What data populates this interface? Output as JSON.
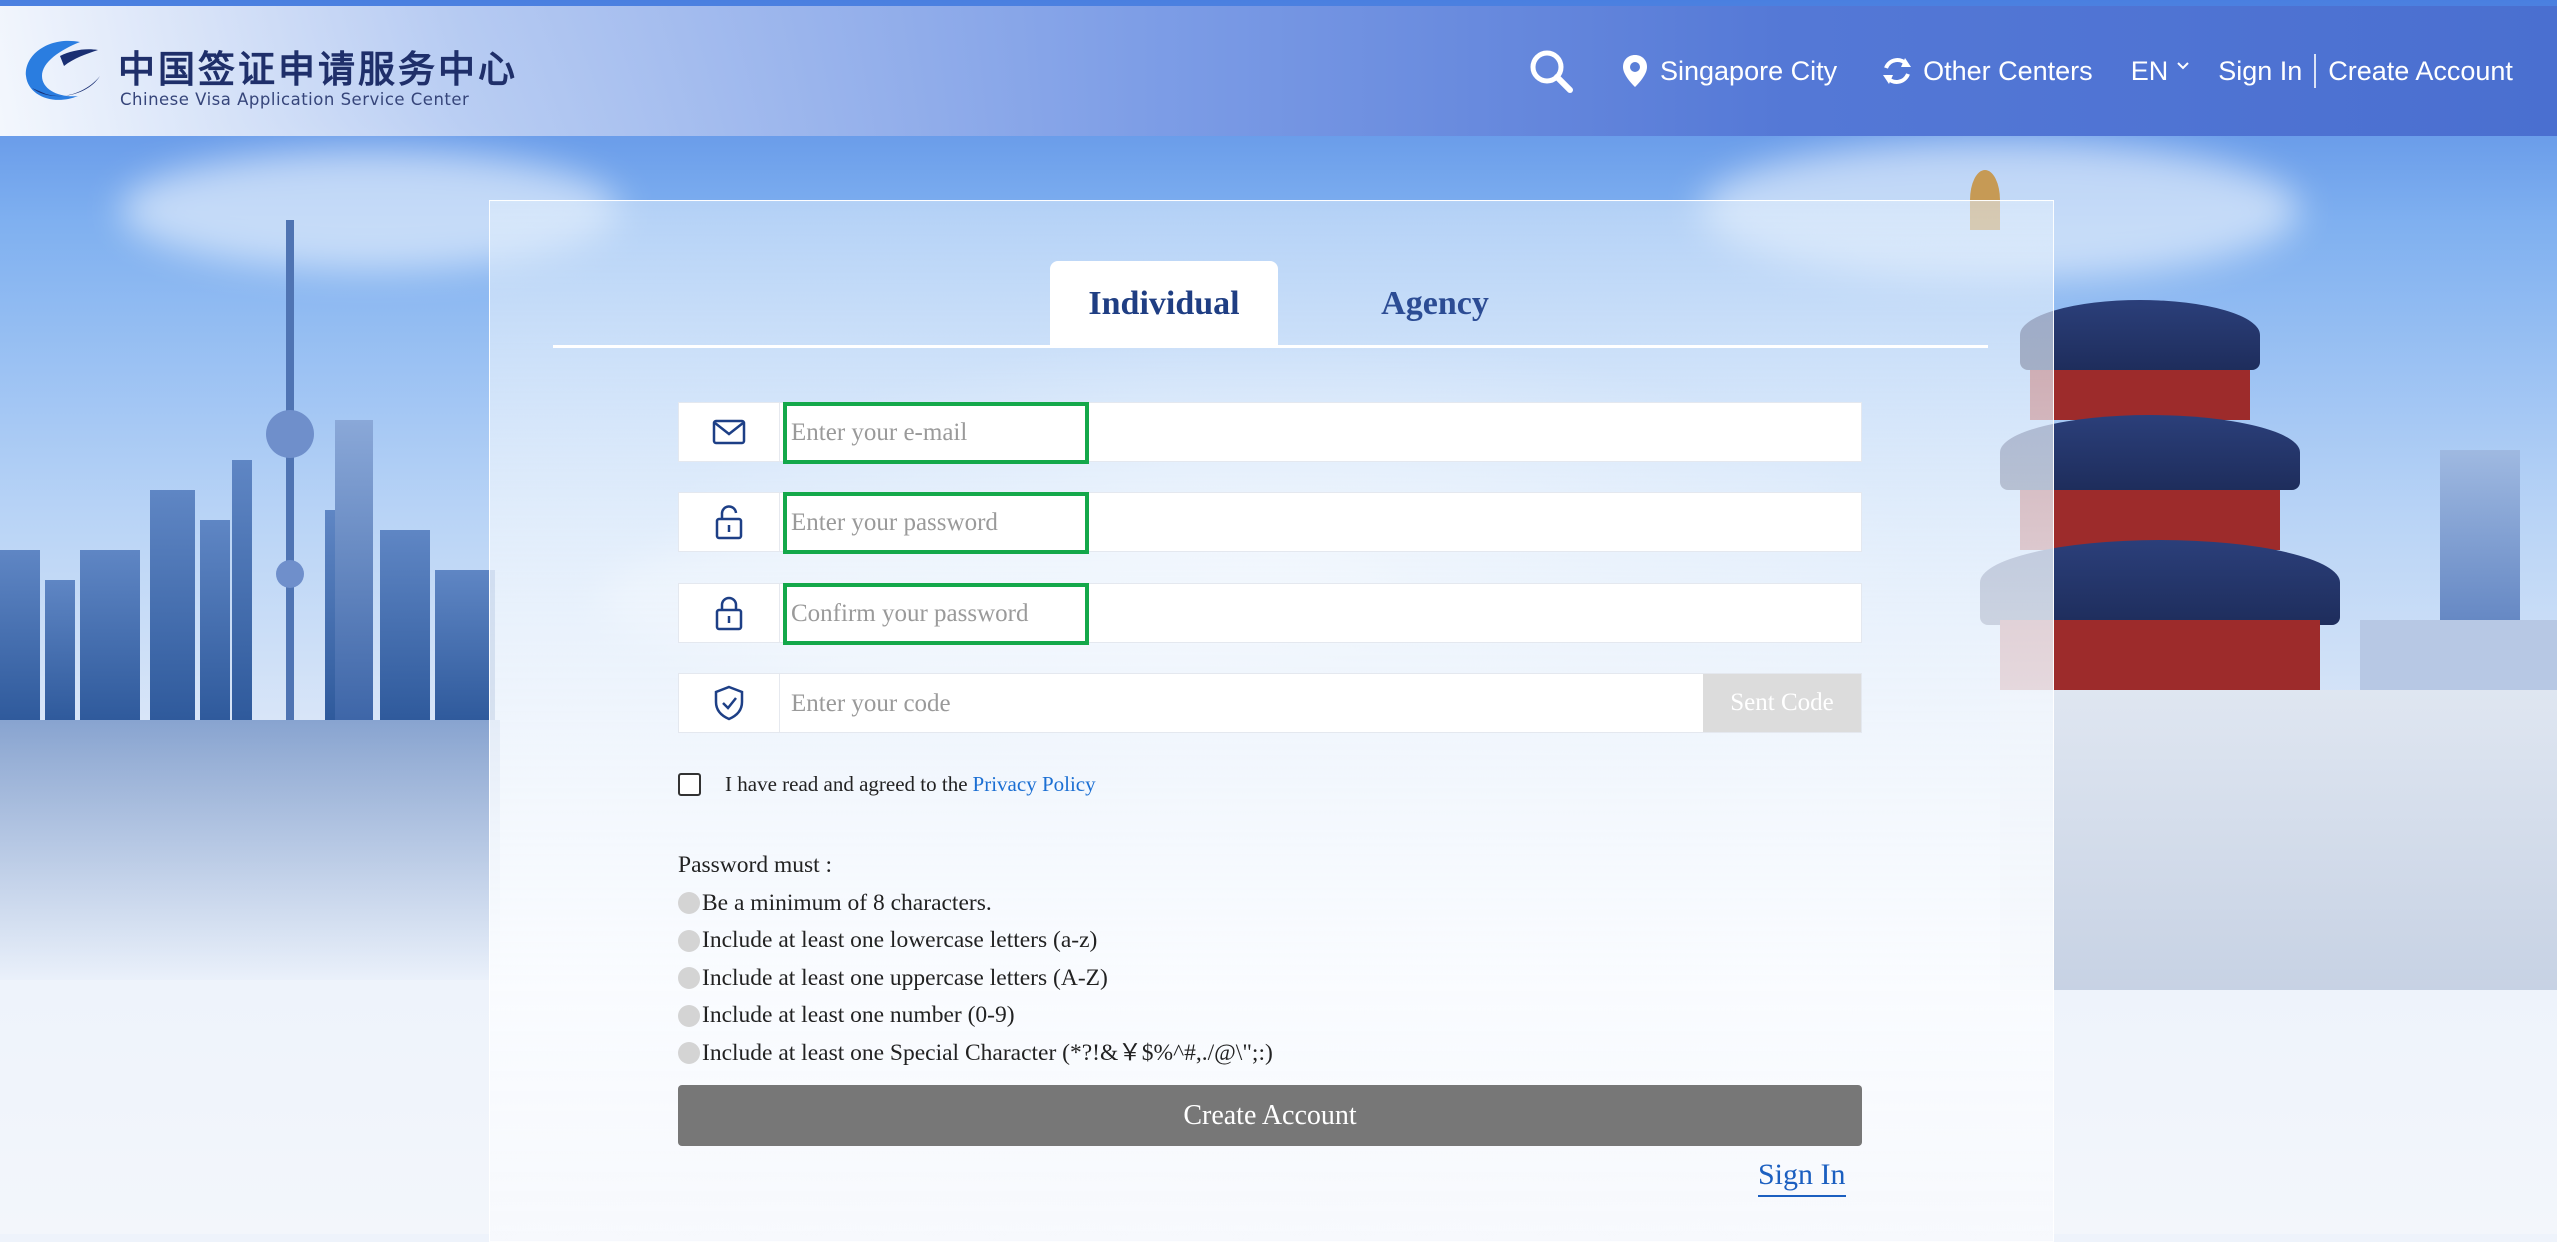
{
  "header": {
    "logo_cn": "中国签证申请服务中心",
    "logo_en": "Chinese Visa Application Service Center",
    "location": "Singapore City",
    "other_centers": "Other Centers",
    "language": "EN",
    "sign_in": "Sign In",
    "create_account": "Create Account"
  },
  "tabs": [
    {
      "label": "Individual",
      "active": true
    },
    {
      "label": "Agency",
      "active": false
    }
  ],
  "form": {
    "email_placeholder": "Enter your e-mail",
    "password_placeholder": "Enter your password",
    "confirm_placeholder": "Confirm your password",
    "code_placeholder": "Enter your code",
    "sent_code": "Sent Code",
    "agree_text": "I have read and agreed to the",
    "privacy_policy": "Privacy Policy"
  },
  "password_rules": {
    "title": "Password must :",
    "items": [
      "Be a minimum of 8 characters.",
      "Include at least one lowercase letters (a-z)",
      "Include at least one uppercase letters (A-Z)",
      "Include at least one number (0-9)",
      "Include at least one Special Character (*?!&￥$%^#,./@\\\";:)"
    ]
  },
  "buttons": {
    "create_account": "Create Account",
    "sign_in": "Sign In"
  },
  "icons": {
    "search": "search-icon",
    "location": "location-pin-icon",
    "refresh": "refresh-icon",
    "email": "envelope-icon",
    "password": "unlock-icon",
    "confirm": "lock-icon",
    "code": "shield-check-icon"
  },
  "colors": {
    "highlight": "#14a84a",
    "primary_text": "#1f3e83",
    "link": "#1b6fd3",
    "button": "#777777"
  }
}
